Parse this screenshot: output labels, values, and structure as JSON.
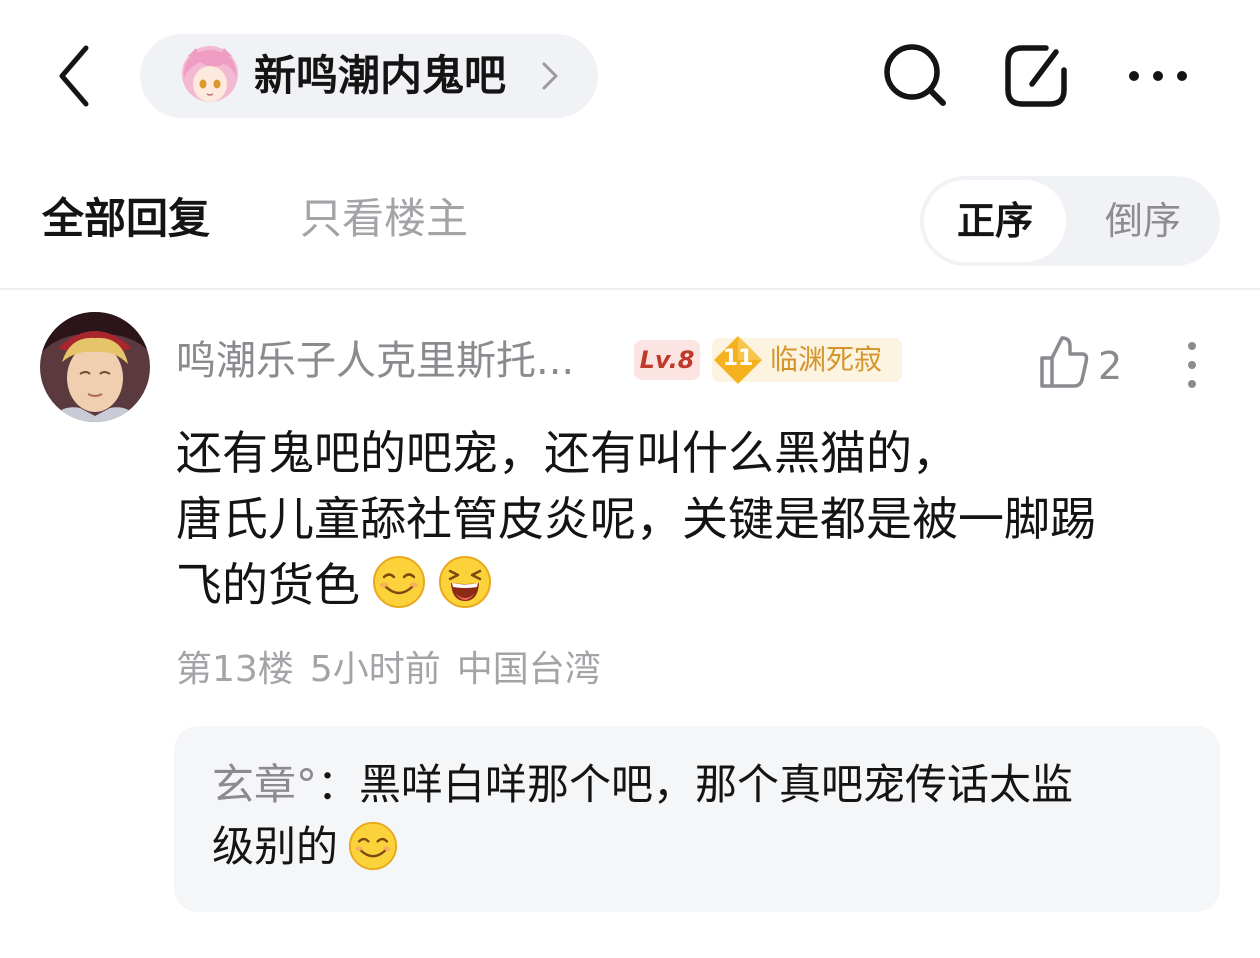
{
  "header": {
    "forum_name": "新鸣潮内鬼吧",
    "icons": [
      "back-icon",
      "chevron-right-icon",
      "search-icon",
      "edit-share-icon",
      "more-horizontal-icon"
    ]
  },
  "tabs": {
    "all_replies": "全部回复",
    "owner_only": "只看楼主",
    "order_asc": "正序",
    "order_desc": "倒序",
    "selected_order": "正序"
  },
  "post": {
    "username": "鸣潮乐子人克里斯托...",
    "level": "Lv.8",
    "title_badge_level": "11",
    "title_badge_name": "临渊死寂",
    "likes": "2",
    "content_lines": [
      "还有鬼吧的吧宠，还有叫什么黑猫的，",
      "唐氏儿童舔社管皮炎呢，关键是都是被一脚踢",
      "飞的货色"
    ],
    "content_emojis": [
      "smirk-emoji",
      "laugh-emoji"
    ],
    "floor": "第13楼",
    "time": "5小时前",
    "location": "中国台湾"
  },
  "reply": {
    "author": "玄章°",
    "separator": "：",
    "line1": "黑咩白咩那个吧，那个真吧宠传话太监",
    "line2": "级别的",
    "emoji": "smirk-emoji"
  },
  "colors": {
    "primary_text": "#141414",
    "secondary_text": "#8a8a8f",
    "muted_text": "#a3a3a8",
    "pill_bg": "#f1f2f5",
    "level_bg": "#fce4e2",
    "level_text": "#c0392b",
    "title_bg": "#fdf3e1",
    "title_text": "#d4962c"
  }
}
